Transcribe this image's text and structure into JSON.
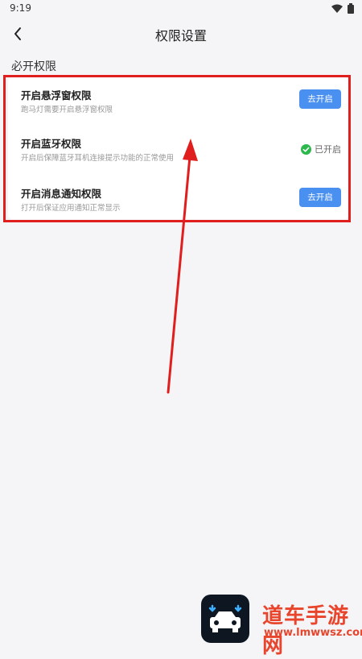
{
  "status_bar": {
    "time": "9:19"
  },
  "nav": {
    "title": "权限设置"
  },
  "section": {
    "title": "必开权限"
  },
  "permissions": [
    {
      "title": "开启悬浮窗权限",
      "desc": "跑马灯需要开启悬浮窗权限",
      "action_label": "去开启"
    },
    {
      "title": "开启蓝牙权限",
      "desc": "开启后保障蓝牙耳机连接提示功能的正常使用",
      "status_label": "已开启"
    },
    {
      "title": "开启消息通知权限",
      "desc": "打开后保证应用通知正常显示",
      "action_label": "去开启"
    }
  ],
  "watermark": {
    "name": "道车手游网",
    "url": "www.lmwwsz.com"
  },
  "colors": {
    "accent": "#4a90f0",
    "highlight": "#e01e1e",
    "enabled_check": "#2db84d",
    "watermark": "#e8452c"
  }
}
